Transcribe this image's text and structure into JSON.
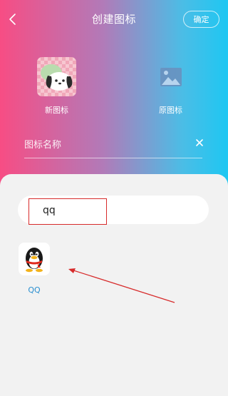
{
  "header": {
    "title": "创建图标",
    "confirm_label": "确定",
    "back_icon": "chevron-left-icon"
  },
  "preview": {
    "new_icon_label": "新图标",
    "original_icon_label": "原图标",
    "original_icon": "image-placeholder-icon"
  },
  "name_field": {
    "placeholder": "图标名称",
    "value": "",
    "clear_icon": "close-icon"
  },
  "search": {
    "value": "qq"
  },
  "results": [
    {
      "label": "QQ",
      "icon": "qq-penguin-icon"
    }
  ],
  "colors": {
    "gradient_start": "#f74d84",
    "gradient_end": "#1ec7f2",
    "highlight_red": "#d72b2b",
    "result_label": "#2a8fd0"
  }
}
